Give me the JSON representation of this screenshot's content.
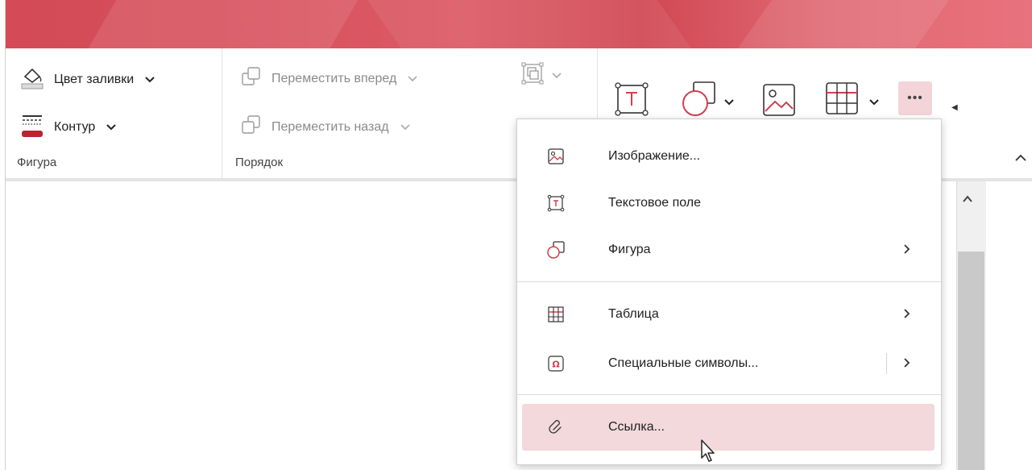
{
  "ribbon": {
    "figure_group": {
      "fill_color_label": "Цвет заливки",
      "outline_label": "Контур",
      "group_label": "Фигура"
    },
    "order_group": {
      "bring_forward_label": "Переместить вперед",
      "send_backward_label": "Переместить назад",
      "group_label": "Порядок"
    },
    "insert_icons": [
      "text-box-icon",
      "shapes-icon",
      "image-icon",
      "table-icon"
    ],
    "more_button_label": "•••"
  },
  "menu": {
    "items": [
      {
        "label": "Изображение...",
        "icon": "image-icon",
        "has_submenu": false
      },
      {
        "label": "Текстовое поле",
        "icon": "text-box-icon",
        "has_submenu": false
      },
      {
        "label": "Фигура",
        "icon": "shapes-icon",
        "has_submenu": true
      },
      {
        "label": "Таблица",
        "icon": "table-icon",
        "has_submenu": true
      },
      {
        "label": "Специальные символы...",
        "icon": "omega-icon",
        "has_submenu": true
      },
      {
        "label": "Ссылка...",
        "icon": "link-icon",
        "has_submenu": false,
        "highlighted": true
      }
    ]
  },
  "colors": {
    "accent": "#d0404e",
    "title_band": "#d64f5c",
    "menu_highlight": "#f3d9dc",
    "more_button_bg": "#f3d4d8"
  }
}
